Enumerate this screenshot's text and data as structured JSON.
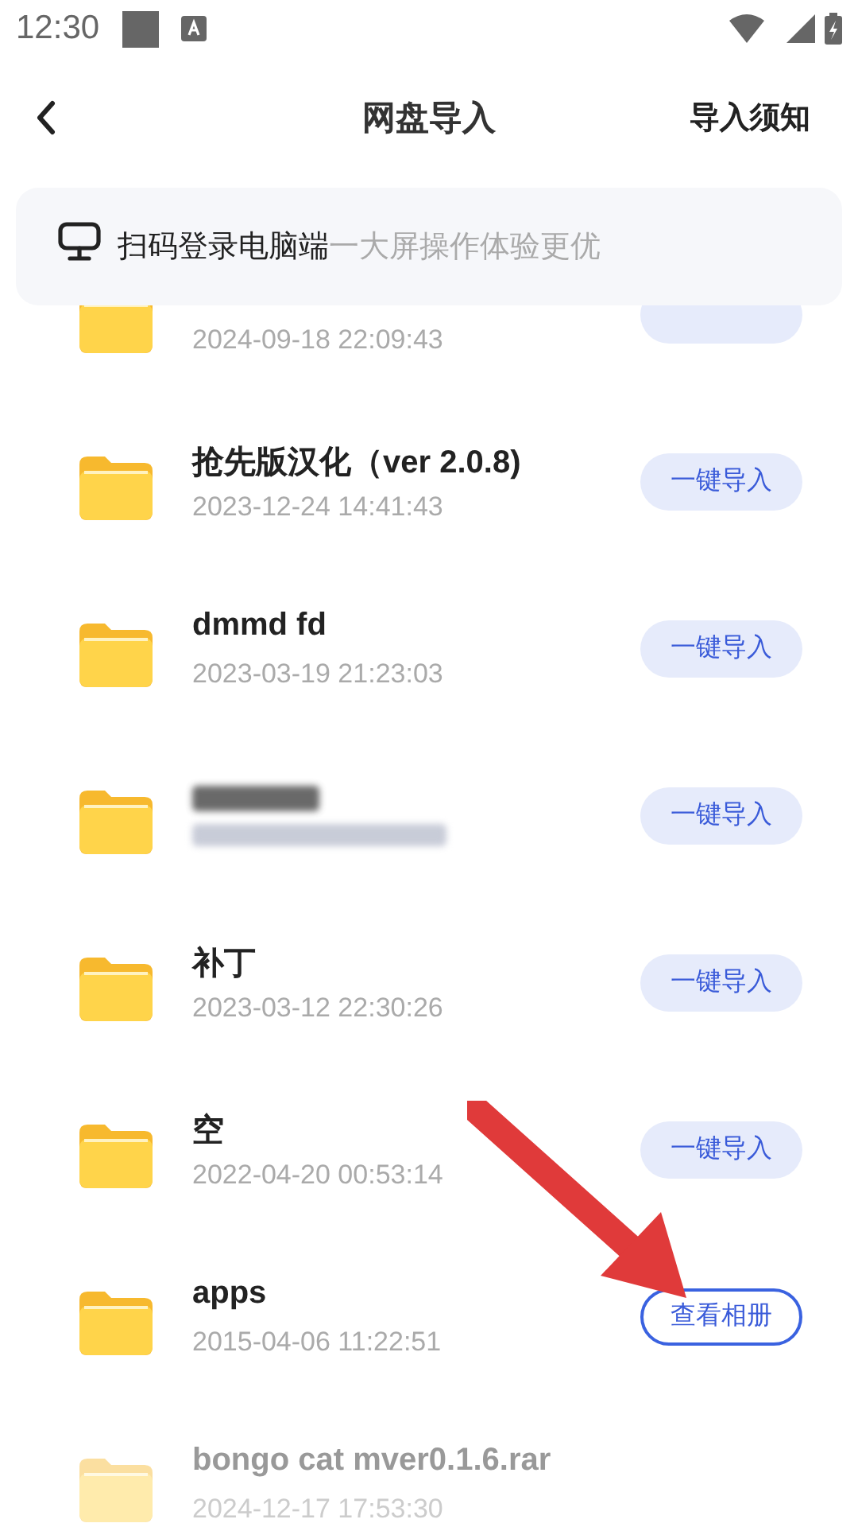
{
  "status_bar": {
    "time": "12:30"
  },
  "header": {
    "title": "网盘导入",
    "action": "导入须知"
  },
  "banner": {
    "text": "扫码登录电脑端",
    "hint": "一大屏操作体验更优"
  },
  "files": [
    {
      "date": "2024-09-18 22:09:43",
      "kind": "import",
      "disabled": false
    },
    {
      "name": "抢先版汉化（ver 2.0.8)",
      "date": "2023-12-24 14:41:43",
      "kind": "import",
      "button": "一键导入",
      "disabled": false
    },
    {
      "name": "dmmd fd",
      "date": "2023-03-19 21:23:03",
      "kind": "import",
      "button": "一键导入",
      "disabled": false
    },
    {
      "kind": "import",
      "button": "一键导入",
      "disabled": false,
      "redacted": true
    },
    {
      "name": "补丁",
      "date": "2023-03-12 22:30:26",
      "kind": "import",
      "button": "一键导入",
      "disabled": false
    },
    {
      "name": "空",
      "date": "2022-04-20 00:53:14",
      "kind": "import",
      "button": "一键导入",
      "disabled": false
    },
    {
      "name": "apps",
      "date": "2015-04-06 11:22:51",
      "kind": "album",
      "button": "查看相册",
      "disabled": false
    },
    {
      "name": "bongo cat mver0.1.6.rar",
      "date": "2024-12-17 17:53:30",
      "kind": "none",
      "disabled": true
    }
  ]
}
